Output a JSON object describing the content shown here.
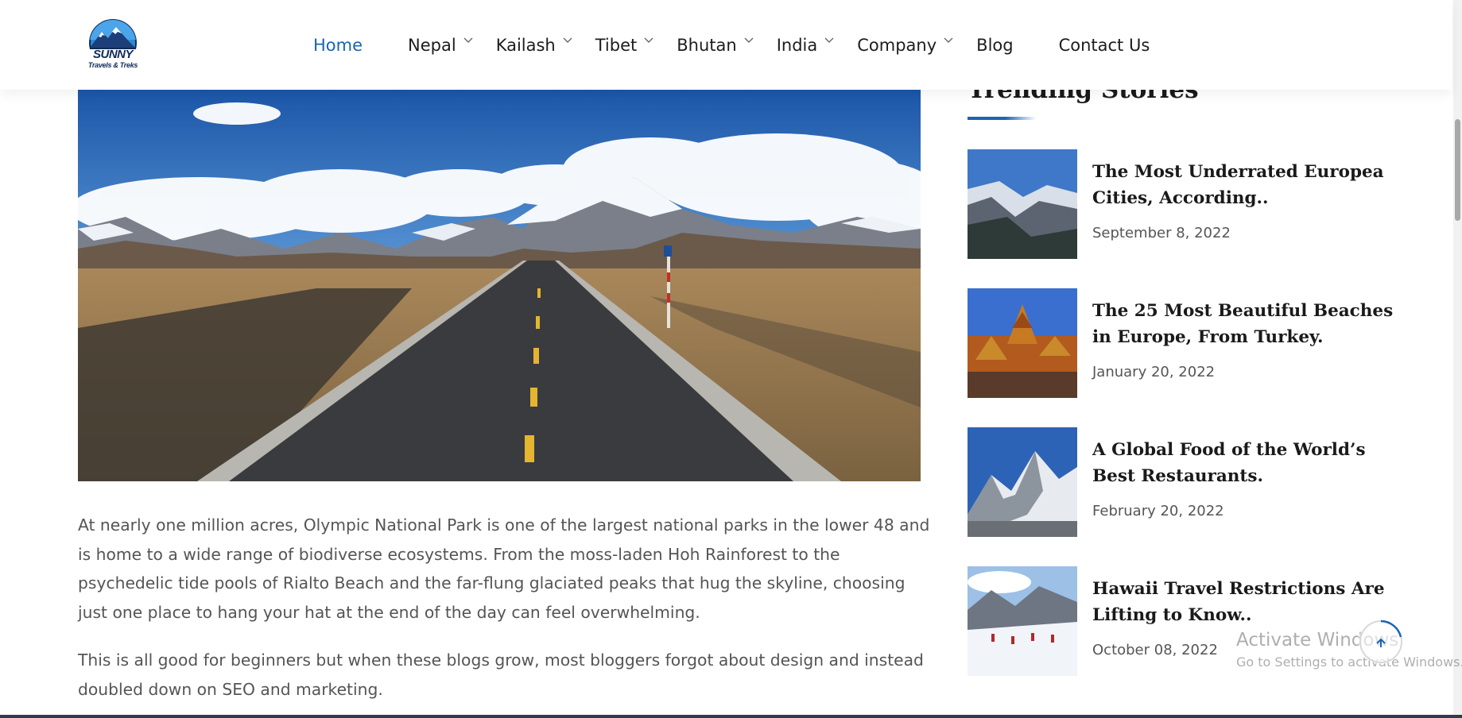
{
  "header": {
    "logo": {
      "brand": "SUNNY",
      "tagline": "Travels & Treks"
    },
    "nav": [
      {
        "label": "Home",
        "active": true,
        "has_dropdown": false
      },
      {
        "label": "Nepal",
        "active": false,
        "has_dropdown": true
      },
      {
        "label": "Kailash",
        "active": false,
        "has_dropdown": true
      },
      {
        "label": "Tibet",
        "active": false,
        "has_dropdown": true
      },
      {
        "label": "Bhutan",
        "active": false,
        "has_dropdown": true
      },
      {
        "label": "India",
        "active": false,
        "has_dropdown": true
      },
      {
        "label": "Company",
        "active": false,
        "has_dropdown": true
      },
      {
        "label": "Blog",
        "active": false,
        "has_dropdown": false
      },
      {
        "label": "Contact Us",
        "active": false,
        "has_dropdown": false
      }
    ]
  },
  "article": {
    "paragraphs": [
      "At nearly one million acres, Olympic National Park is one of the largest national parks in the lower 48 and is home to a wide range of biodiverse ecosystems. From the moss-laden Hoh Rainforest to the psychedelic tide pools of Rialto Beach and the far-flung glaciated peaks that hug the skyline, choosing just one place to hang your hat at the end of the day can feel overwhelming.",
      "This is all good for beginners but when these blogs grow, most bloggers forgot about design and instead doubled down on SEO and marketing."
    ]
  },
  "sidebar": {
    "title": "Trending Stories",
    "stories": [
      {
        "title": "The Most Underrated Europea Cities, According..",
        "date": "September 8, 2022"
      },
      {
        "title": "The 25 Most Beautiful Beaches in Europe, From Turkey.",
        "date": "January 20, 2022"
      },
      {
        "title": "A Global Food of the World’s Best Restaurants.",
        "date": "February 20, 2022"
      },
      {
        "title": "Hawaii Travel Restrictions Are Lifting to Know..",
        "date": "October 08, 2022"
      }
    ]
  },
  "watermark": {
    "line1": "Activate Windows",
    "line2": "Go to Settings to activate Windows."
  },
  "colors": {
    "accent": "#1a64b4",
    "text_dark": "#1a1a1a",
    "text_body": "#555555"
  },
  "icons": {
    "scroll_up": "arrow-up-icon",
    "dropdown": "chevron-down-icon"
  }
}
